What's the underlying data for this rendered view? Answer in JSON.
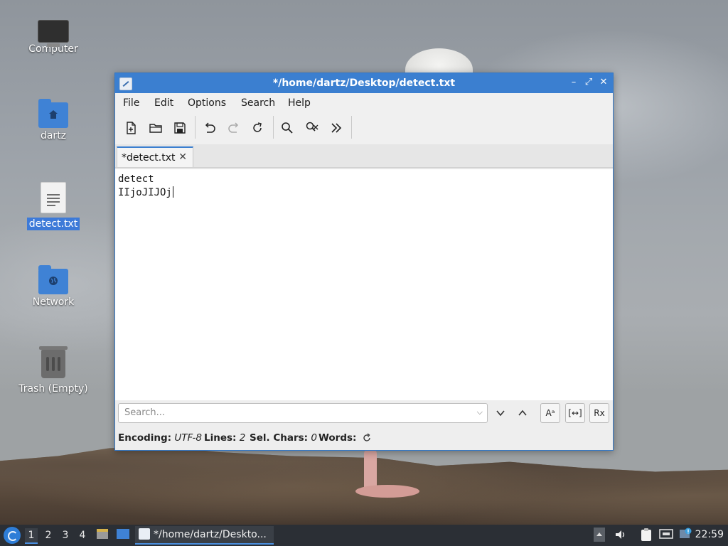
{
  "desktop": {
    "icons": [
      {
        "label": "Computer",
        "icon": "computer-icon"
      },
      {
        "label": "dartz",
        "icon": "home-folder-icon"
      },
      {
        "label": "detect.txt",
        "icon": "text-file-icon",
        "selected": true
      },
      {
        "label": "Network",
        "icon": "network-folder-icon"
      },
      {
        "label": "Trash (Empty)",
        "icon": "trash-icon"
      }
    ]
  },
  "window": {
    "title": "*/home/dartz/Desktop/detect.txt",
    "controls": {
      "minimize": "–",
      "maximize": "⤢",
      "close": "✕"
    },
    "menu": [
      "File",
      "Edit",
      "Options",
      "Search",
      "Help"
    ],
    "toolbar": [
      "new-document-icon",
      "open-folder-icon",
      "save-icon",
      "undo-icon",
      "redo-icon",
      "reload-icon",
      "find-icon",
      "replace-icon",
      "go-to-line-icon"
    ],
    "tab": {
      "label": "*detect.txt",
      "close": "✕"
    },
    "editor": {
      "lines": [
        "detect",
        "IIjoJIJOj"
      ]
    },
    "search": {
      "placeholder": "Search...",
      "value": ""
    },
    "search_options": {
      "match_case": "Aᵃ",
      "whole_word": "[↔]",
      "regex": "Rx"
    },
    "status": {
      "encoding_label": "Encoding:",
      "encoding_value": "UTF-8",
      "lines_label": "Lines:",
      "lines_value": "2",
      "sel_label": "Sel. Chars:",
      "sel_value": "0",
      "words_label": "Words:"
    }
  },
  "taskbar": {
    "workspaces": [
      "1",
      "2",
      "3",
      "4"
    ],
    "active_workspace": "1",
    "task_label": "*/home/dartz/Deskto...",
    "clock": "22:59"
  },
  "colors": {
    "accent": "#3b7fd0",
    "taskbar": "#2b2f35",
    "selection": "#3d7ad8"
  }
}
